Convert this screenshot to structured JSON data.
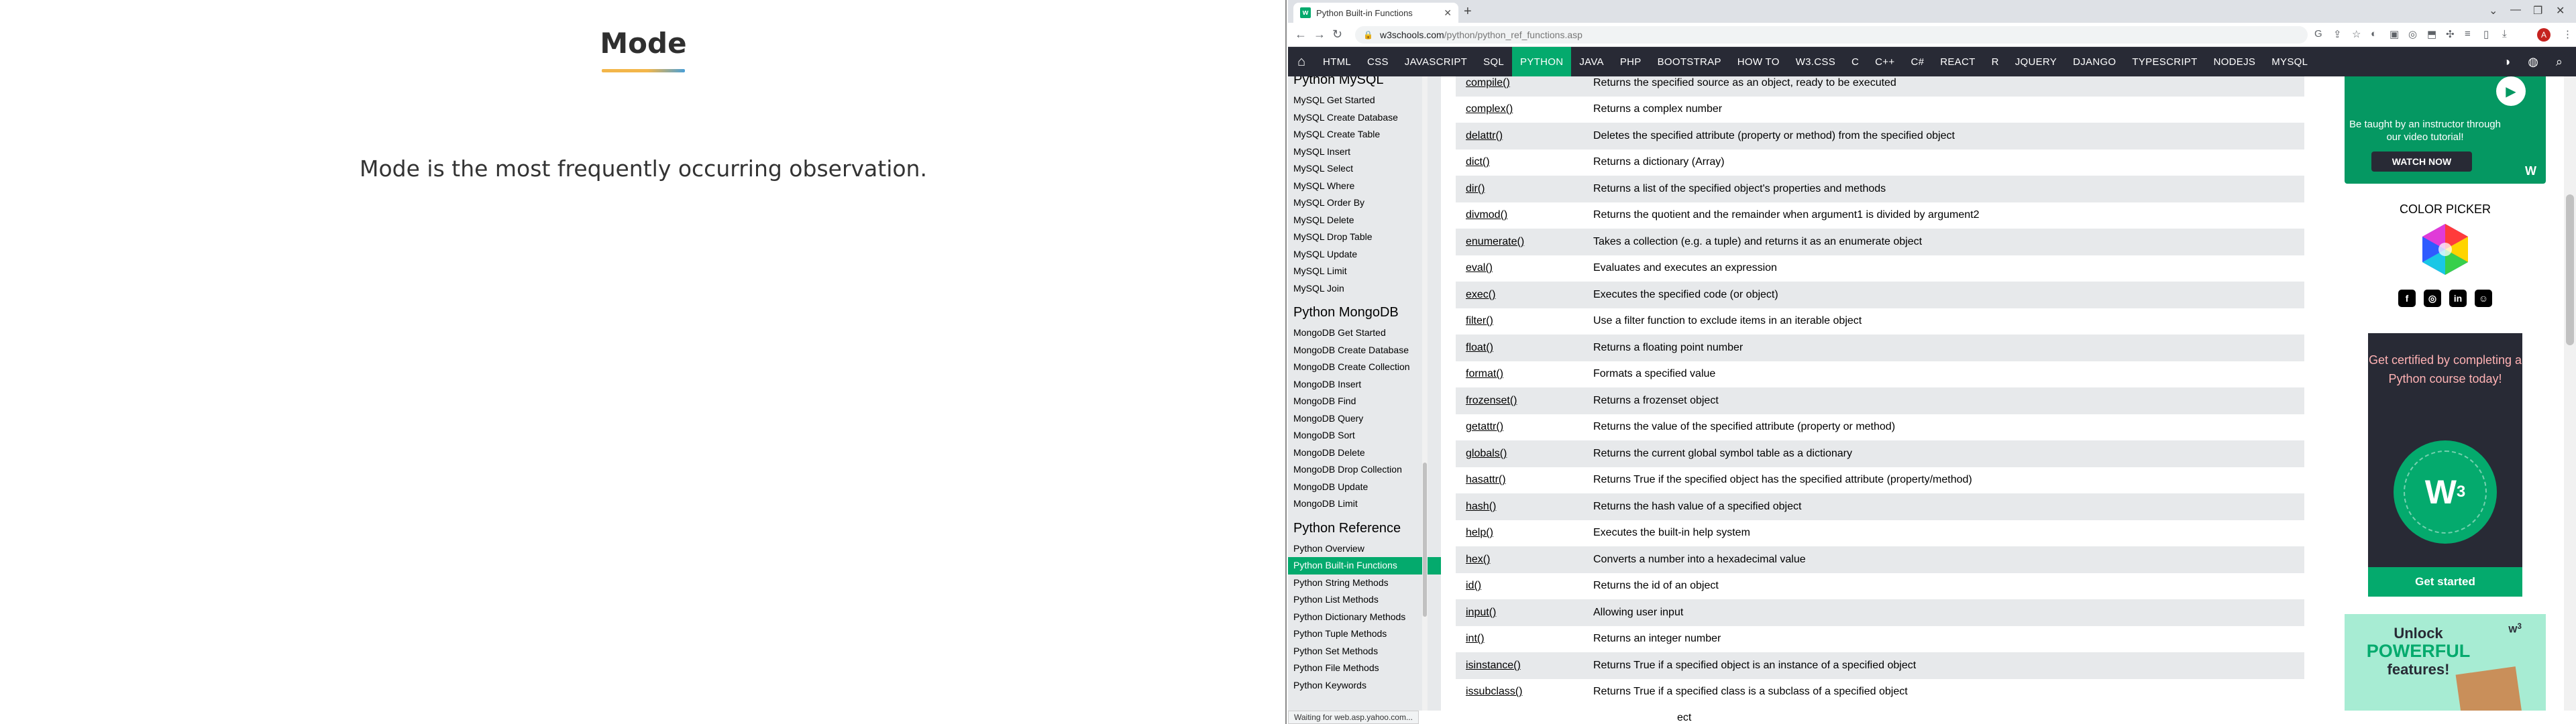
{
  "slide": {
    "title": "Mode",
    "text": "Mode is the most frequently occurring observation."
  },
  "browser": {
    "tab_title": "Python Built-in Functions",
    "url_host": "w3schools.com",
    "url_path": "/python/python_ref_functions.asp",
    "status_text": "Waiting for web.asp.yahoo.com..."
  },
  "topnav": {
    "items": [
      "HTML",
      "CSS",
      "JAVASCRIPT",
      "SQL",
      "PYTHON",
      "JAVA",
      "PHP",
      "BOOTSTRAP",
      "HOW TO",
      "W3.CSS",
      "C",
      "C++",
      "C#",
      "REACT",
      "R",
      "JQUERY",
      "DJANGO",
      "TYPESCRIPT",
      "NODEJS",
      "MYSQL"
    ],
    "active": "PYTHON"
  },
  "sidebar": {
    "mysql_heading": "Python MySQL",
    "mysql": [
      "MySQL Get Started",
      "MySQL Create Database",
      "MySQL Create Table",
      "MySQL Insert",
      "MySQL Select",
      "MySQL Where",
      "MySQL Order By",
      "MySQL Delete",
      "MySQL Drop Table",
      "MySQL Update",
      "MySQL Limit",
      "MySQL Join"
    ],
    "mongo_heading": "Python MongoDB",
    "mongo": [
      "MongoDB Get Started",
      "MongoDB Create Database",
      "MongoDB Create Collection",
      "MongoDB Insert",
      "MongoDB Find",
      "MongoDB Query",
      "MongoDB Sort",
      "MongoDB Delete",
      "MongoDB Drop Collection",
      "MongoDB Update",
      "MongoDB Limit"
    ],
    "ref_heading": "Python Reference",
    "ref": [
      "Python Overview",
      "Python Built-in Functions",
      "Python String Methods",
      "Python List Methods",
      "Python Dictionary Methods",
      "Python Tuple Methods",
      "Python Set Methods",
      "Python File Methods",
      "Python Keywords"
    ],
    "active": "Python Built-in Functions"
  },
  "functions": [
    {
      "name": "compile()",
      "desc": "Returns the specified source as an object, ready to be executed"
    },
    {
      "name": "complex()",
      "desc": "Returns a complex number"
    },
    {
      "name": "delattr()",
      "desc": "Deletes the specified attribute (property or method) from the specified object"
    },
    {
      "name": "dict()",
      "desc": "Returns a dictionary (Array)"
    },
    {
      "name": "dir()",
      "desc": "Returns a list of the specified object's properties and methods"
    },
    {
      "name": "divmod()",
      "desc": "Returns the quotient and the remainder when argument1 is divided by argument2"
    },
    {
      "name": "enumerate()",
      "desc": "Takes a collection (e.g. a tuple) and returns it as an enumerate object"
    },
    {
      "name": "eval()",
      "desc": "Evaluates and executes an expression"
    },
    {
      "name": "exec()",
      "desc": "Executes the specified code (or object)"
    },
    {
      "name": "filter()",
      "desc": "Use a filter function to exclude items in an iterable object"
    },
    {
      "name": "float()",
      "desc": "Returns a floating point number"
    },
    {
      "name": "format()",
      "desc": "Formats a specified value"
    },
    {
      "name": "frozenset()",
      "desc": "Returns a frozenset object"
    },
    {
      "name": "getattr()",
      "desc": "Returns the value of the specified attribute (property or method)"
    },
    {
      "name": "globals()",
      "desc": "Returns the current global symbol table as a dictionary"
    },
    {
      "name": "hasattr()",
      "desc": "Returns True if the specified object has the specified attribute (property/method)"
    },
    {
      "name": "hash()",
      "desc": "Returns the hash value of a specified object"
    },
    {
      "name": "help()",
      "desc": "Executes the built-in help system"
    },
    {
      "name": "hex()",
      "desc": "Converts a number into a hexadecimal value"
    },
    {
      "name": "id()",
      "desc": "Returns the id of an object"
    },
    {
      "name": "input()",
      "desc": "Allowing user input"
    },
    {
      "name": "int()",
      "desc": "Returns an integer number"
    },
    {
      "name": "isinstance()",
      "desc": "Returns True if a specified object is an instance of a specified object"
    },
    {
      "name": "issubclass()",
      "desc": "Returns True if a specified class is a subclass of a specified object"
    }
  ],
  "table_tail": "ect",
  "ads": {
    "video_text": "Be taught by an instructor through our video tutorial!",
    "watch_label": "WATCH NOW",
    "color_picker": "COLOR PICKER",
    "cert_text": "Get certified by completing a Python course today!",
    "cert_button": "Get started",
    "unlock_line1": "Unlock",
    "unlock_line2": "POWERFUL",
    "unlock_line3": "features!"
  },
  "colors": {
    "brand_green": "#04aa6d",
    "nav_dark": "#282a35",
    "sidebar_bg": "#e7e9eb"
  }
}
